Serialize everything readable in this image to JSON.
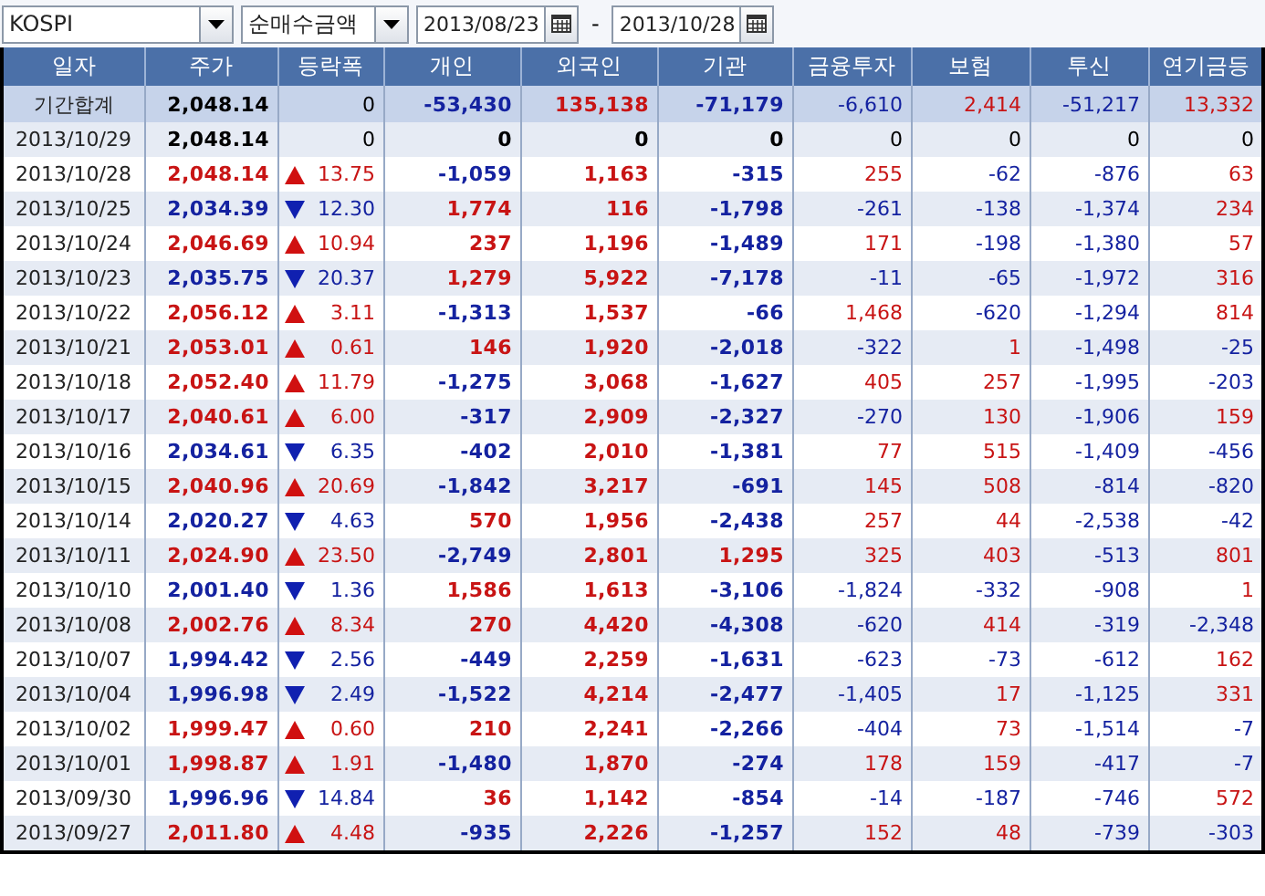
{
  "toolbar": {
    "market": "KOSPI",
    "mode": "순매수금액",
    "date_from": "2013/08/23",
    "separator": "-",
    "date_to": "2013/10/28"
  },
  "table": {
    "columns": [
      "일자",
      "주가",
      "등락폭",
      "개인",
      "외국인",
      "기관",
      "금융투자",
      "보험",
      "투신",
      "연기금등"
    ],
    "rows": [
      {
        "kind": "total",
        "date": "기간합계",
        "price": "2,048.14",
        "rising": false,
        "falling": false,
        "change": "0",
        "values": [
          "-53,430",
          "135,138",
          "-71,179",
          "-6,610",
          "2,414",
          "-51,217",
          "13,332"
        ]
      },
      {
        "kind": "day",
        "date": "2013/10/29",
        "price": "2,048.14",
        "rising": false,
        "falling": false,
        "change": "0",
        "values": [
          "0",
          "0",
          "0",
          "0",
          "0",
          "0",
          "0"
        ]
      },
      {
        "kind": "day",
        "date": "2013/10/28",
        "price": "2,048.14",
        "rising": true,
        "falling": false,
        "change": "13.75",
        "values": [
          "-1,059",
          "1,163",
          "-315",
          "255",
          "-62",
          "-876",
          "63"
        ]
      },
      {
        "kind": "day",
        "date": "2013/10/25",
        "price": "2,034.39",
        "rising": false,
        "falling": true,
        "change": "12.30",
        "values": [
          "1,774",
          "116",
          "-1,798",
          "-261",
          "-138",
          "-1,374",
          "234"
        ]
      },
      {
        "kind": "day",
        "date": "2013/10/24",
        "price": "2,046.69",
        "rising": true,
        "falling": false,
        "change": "10.94",
        "values": [
          "237",
          "1,196",
          "-1,489",
          "171",
          "-198",
          "-1,380",
          "57"
        ]
      },
      {
        "kind": "day",
        "date": "2013/10/23",
        "price": "2,035.75",
        "rising": false,
        "falling": true,
        "change": "20.37",
        "values": [
          "1,279",
          "5,922",
          "-7,178",
          "-11",
          "-65",
          "-1,972",
          "316"
        ]
      },
      {
        "kind": "day",
        "date": "2013/10/22",
        "price": "2,056.12",
        "rising": true,
        "falling": false,
        "change": "3.11",
        "values": [
          "-1,313",
          "1,537",
          "-66",
          "1,468",
          "-620",
          "-1,294",
          "814"
        ]
      },
      {
        "kind": "day",
        "date": "2013/10/21",
        "price": "2,053.01",
        "rising": true,
        "falling": false,
        "change": "0.61",
        "values": [
          "146",
          "1,920",
          "-2,018",
          "-322",
          "1",
          "-1,498",
          "-25"
        ]
      },
      {
        "kind": "day",
        "date": "2013/10/18",
        "price": "2,052.40",
        "rising": true,
        "falling": false,
        "change": "11.79",
        "values": [
          "-1,275",
          "3,068",
          "-1,627",
          "405",
          "257",
          "-1,995",
          "-203"
        ]
      },
      {
        "kind": "day",
        "date": "2013/10/17",
        "price": "2,040.61",
        "rising": true,
        "falling": false,
        "change": "6.00",
        "values": [
          "-317",
          "2,909",
          "-2,327",
          "-270",
          "130",
          "-1,906",
          "159"
        ]
      },
      {
        "kind": "day",
        "date": "2013/10/16",
        "price": "2,034.61",
        "rising": false,
        "falling": true,
        "change": "6.35",
        "values": [
          "-402",
          "2,010",
          "-1,381",
          "77",
          "515",
          "-1,409",
          "-456"
        ]
      },
      {
        "kind": "day",
        "date": "2013/10/15",
        "price": "2,040.96",
        "rising": true,
        "falling": false,
        "change": "20.69",
        "values": [
          "-1,842",
          "3,217",
          "-691",
          "145",
          "508",
          "-814",
          "-820"
        ]
      },
      {
        "kind": "day",
        "date": "2013/10/14",
        "price": "2,020.27",
        "rising": false,
        "falling": true,
        "change": "4.63",
        "values": [
          "570",
          "1,956",
          "-2,438",
          "257",
          "44",
          "-2,538",
          "-42"
        ]
      },
      {
        "kind": "day",
        "date": "2013/10/11",
        "price": "2,024.90",
        "rising": true,
        "falling": false,
        "change": "23.50",
        "values": [
          "-2,749",
          "2,801",
          "1,295",
          "325",
          "403",
          "-513",
          "801"
        ]
      },
      {
        "kind": "day",
        "date": "2013/10/10",
        "price": "2,001.40",
        "rising": false,
        "falling": true,
        "change": "1.36",
        "values": [
          "1,586",
          "1,613",
          "-3,106",
          "-1,824",
          "-332",
          "-908",
          "1"
        ]
      },
      {
        "kind": "day",
        "date": "2013/10/08",
        "price": "2,002.76",
        "rising": true,
        "falling": false,
        "change": "8.34",
        "values": [
          "270",
          "4,420",
          "-4,308",
          "-620",
          "414",
          "-319",
          "-2,348"
        ]
      },
      {
        "kind": "day",
        "date": "2013/10/07",
        "price": "1,994.42",
        "rising": false,
        "falling": true,
        "change": "2.56",
        "values": [
          "-449",
          "2,259",
          "-1,631",
          "-623",
          "-73",
          "-612",
          "162"
        ]
      },
      {
        "kind": "day",
        "date": "2013/10/04",
        "price": "1,996.98",
        "rising": false,
        "falling": true,
        "change": "2.49",
        "values": [
          "-1,522",
          "4,214",
          "-2,477",
          "-1,405",
          "17",
          "-1,125",
          "331"
        ]
      },
      {
        "kind": "day",
        "date": "2013/10/02",
        "price": "1,999.47",
        "rising": true,
        "falling": false,
        "change": "0.60",
        "values": [
          "210",
          "2,241",
          "-2,266",
          "-404",
          "73",
          "-1,514",
          "-7"
        ]
      },
      {
        "kind": "day",
        "date": "2013/10/01",
        "price": "1,998.87",
        "rising": true,
        "falling": false,
        "change": "1.91",
        "values": [
          "-1,480",
          "1,870",
          "-274",
          "178",
          "159",
          "-417",
          "-7"
        ]
      },
      {
        "kind": "day",
        "date": "2013/09/30",
        "price": "1,996.96",
        "rising": false,
        "falling": true,
        "change": "14.84",
        "values": [
          "36",
          "1,142",
          "-854",
          "-14",
          "-187",
          "-746",
          "572"
        ]
      },
      {
        "kind": "day",
        "date": "2013/09/27",
        "price": "2,011.80",
        "rising": true,
        "falling": false,
        "change": "4.48",
        "values": [
          "-935",
          "2,226",
          "-1,257",
          "152",
          "48",
          "-739",
          "-303"
        ]
      }
    ]
  }
}
